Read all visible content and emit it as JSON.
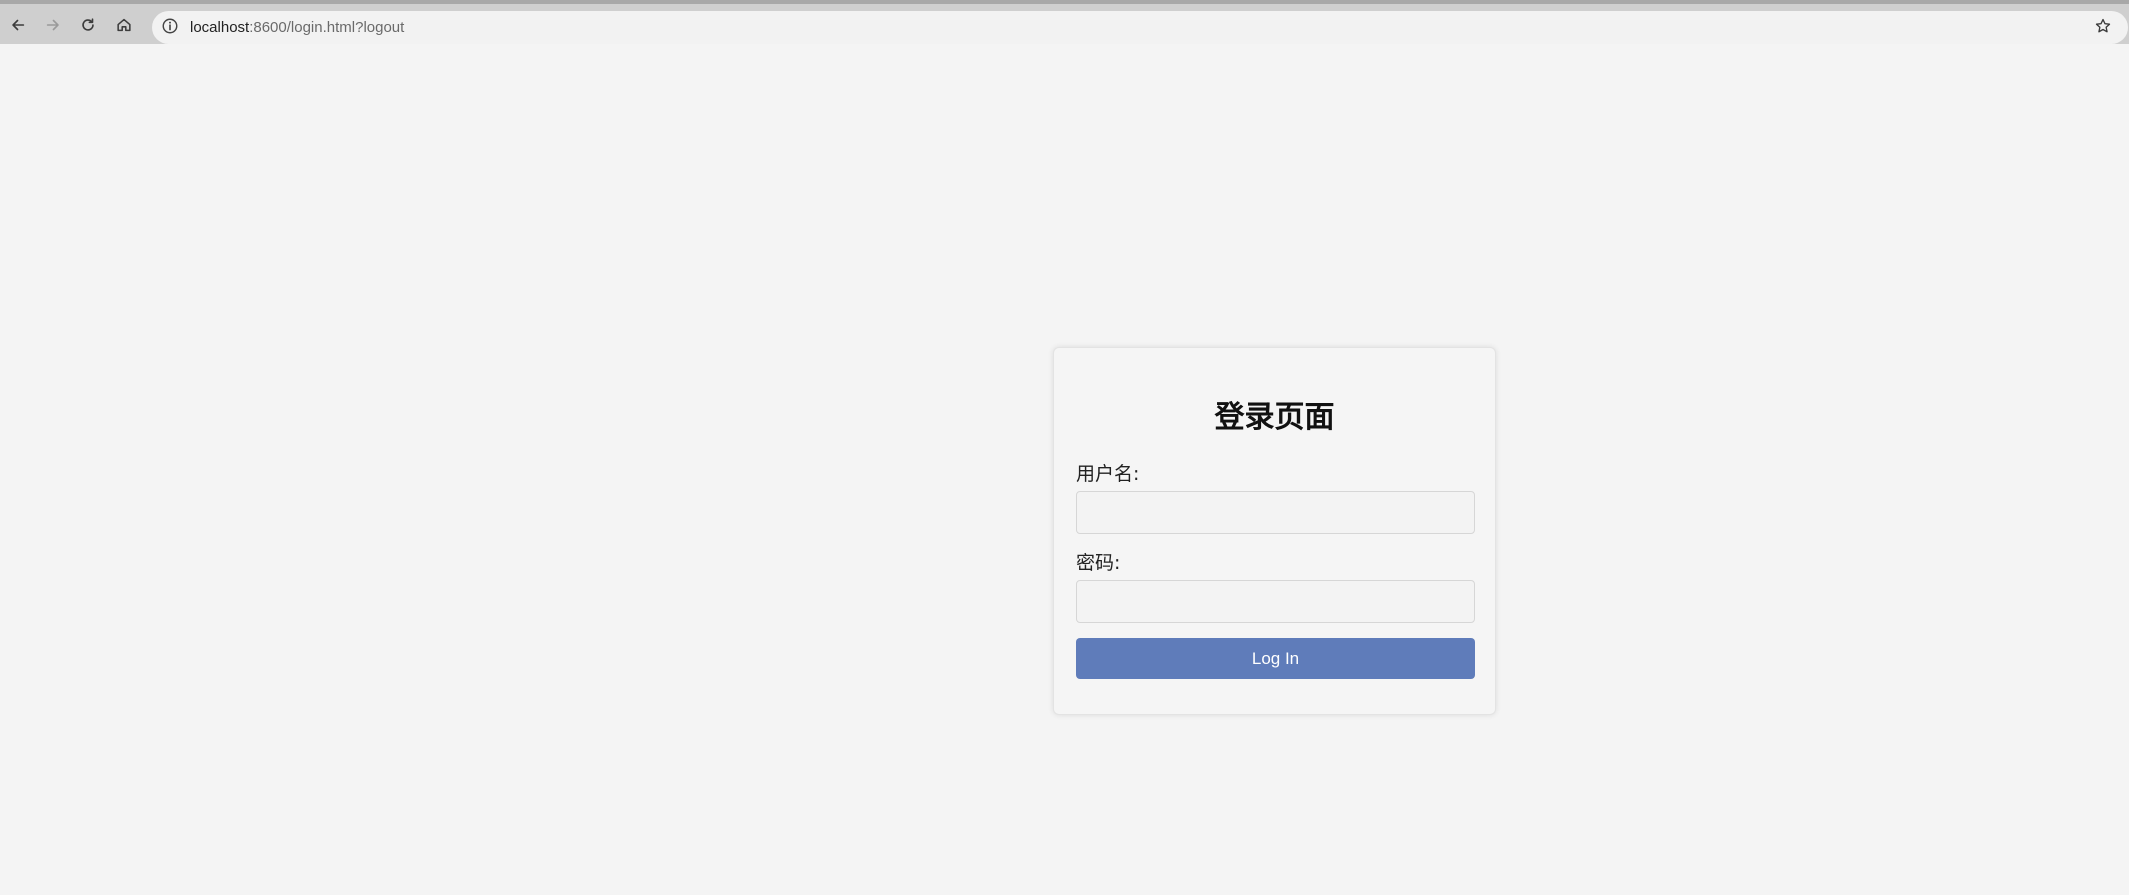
{
  "browser": {
    "url_host": "localhost",
    "url_rest": ":8600/login.html?logout",
    "back_icon": "arrow-left-icon",
    "forward_icon": "arrow-right-icon",
    "reload_icon": "reload-icon",
    "home_icon": "home-icon",
    "site_info_icon": "info-icon",
    "bookmark_icon": "star-icon"
  },
  "login": {
    "title": "登录页面",
    "username_label": "用户名:",
    "username_value": "",
    "password_label": "密码:",
    "password_value": "",
    "submit_label": "Log In"
  },
  "colors": {
    "page_background": "#f4f4f4",
    "button_background": "#5f7cba",
    "button_text": "#ffffff"
  }
}
